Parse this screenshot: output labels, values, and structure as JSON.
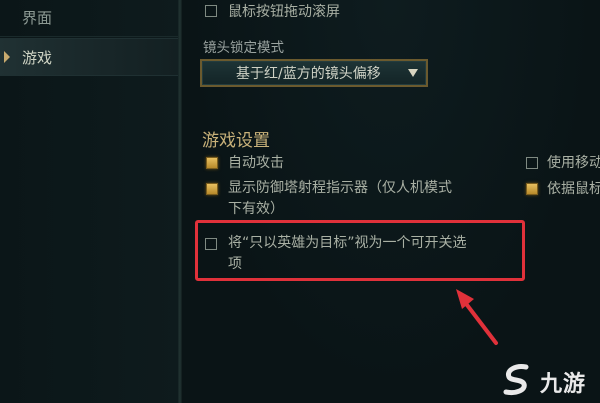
{
  "sidebar": {
    "items": [
      {
        "label": "界面",
        "active": false
      },
      {
        "label": "游戏",
        "active": true
      }
    ]
  },
  "settings": {
    "mouse_drag_scroll": {
      "label": "鼠标按钮拖动滚屏",
      "checked": false
    },
    "camera_lock_mode": {
      "title": "镜头锁定模式",
      "selected": "基于红/蓝方的镜头偏移"
    },
    "game_settings": {
      "title": "游戏设置",
      "auto_attack": {
        "label": "自动攻击",
        "checked": true
      },
      "use_move": {
        "label": "使用移动",
        "checked": false
      },
      "tower_range": {
        "label_line1": "显示防御塔射程指示器（仅人机模式",
        "label_line2": "下有效）",
        "checked": true
      },
      "based_on_mouse": {
        "label": "依据鼠标",
        "checked": true
      },
      "target_champions_toggle": {
        "label_line1": "将“只以英雄为目标”视为一个可开关选",
        "label_line2": "项",
        "checked": false
      }
    }
  },
  "annotation": {
    "color": "#e0313a"
  },
  "watermark": {
    "text": "九游"
  },
  "colors": {
    "accent_gold": "#c8aa6e",
    "background": "#0a1416",
    "highlight_red": "#e0313a"
  }
}
